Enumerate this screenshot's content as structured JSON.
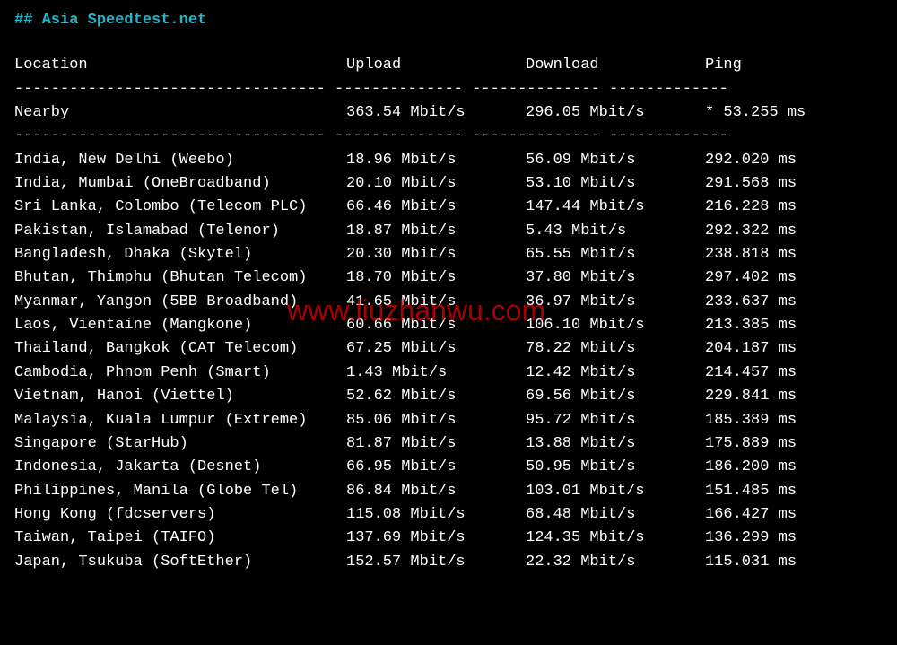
{
  "title": "## Asia Speedtest.net",
  "headers": {
    "location": "Location",
    "upload": "Upload",
    "download": "Download",
    "ping": "Ping"
  },
  "divider_header": "---------------------------------- -------------- -------------- -------------",
  "nearby": {
    "location": "Nearby",
    "upload": "363.54 Mbit/s",
    "download": "296.05 Mbit/s",
    "ping": "* 53.255 ms"
  },
  "divider_nearby": "---------------------------------- -------------- -------------- -------------",
  "rows": [
    {
      "location": "India, New Delhi (Weebo)",
      "upload": "18.96 Mbit/s",
      "download": "56.09 Mbit/s",
      "ping": "292.020 ms"
    },
    {
      "location": "India, Mumbai (OneBroadband)",
      "upload": "20.10 Mbit/s",
      "download": "53.10 Mbit/s",
      "ping": "291.568 ms"
    },
    {
      "location": "Sri Lanka, Colombo (Telecom PLC)",
      "upload": "66.46 Mbit/s",
      "download": "147.44 Mbit/s",
      "ping": "216.228 ms"
    },
    {
      "location": "Pakistan, Islamabad (Telenor)",
      "upload": "18.87 Mbit/s",
      "download": "5.43 Mbit/s",
      "ping": "292.322 ms"
    },
    {
      "location": "Bangladesh, Dhaka (Skytel)",
      "upload": "20.30 Mbit/s",
      "download": "65.55 Mbit/s",
      "ping": "238.818 ms"
    },
    {
      "location": "Bhutan, Thimphu (Bhutan Telecom)",
      "upload": "18.70 Mbit/s",
      "download": "37.80 Mbit/s",
      "ping": "297.402 ms"
    },
    {
      "location": "Myanmar, Yangon (5BB Broadband)",
      "upload": "41.65 Mbit/s",
      "download": "36.97 Mbit/s",
      "ping": "233.637 ms"
    },
    {
      "location": "Laos, Vientaine (Mangkone)",
      "upload": "60.66 Mbit/s",
      "download": "106.10 Mbit/s",
      "ping": "213.385 ms"
    },
    {
      "location": "Thailand, Bangkok (CAT Telecom)",
      "upload": "67.25 Mbit/s",
      "download": "78.22 Mbit/s",
      "ping": "204.187 ms"
    },
    {
      "location": "Cambodia, Phnom Penh (Smart)",
      "upload": "1.43 Mbit/s",
      "download": "12.42 Mbit/s",
      "ping": "214.457 ms"
    },
    {
      "location": "Vietnam, Hanoi (Viettel)",
      "upload": "52.62 Mbit/s",
      "download": "69.56 Mbit/s",
      "ping": "229.841 ms"
    },
    {
      "location": "Malaysia, Kuala Lumpur (Extreme)",
      "upload": "85.06 Mbit/s",
      "download": "95.72 Mbit/s",
      "ping": "185.389 ms"
    },
    {
      "location": "Singapore (StarHub)",
      "upload": "81.87 Mbit/s",
      "download": "13.88 Mbit/s",
      "ping": "175.889 ms"
    },
    {
      "location": "Indonesia, Jakarta (Desnet)",
      "upload": "66.95 Mbit/s",
      "download": "50.95 Mbit/s",
      "ping": "186.200 ms"
    },
    {
      "location": "Philippines, Manila (Globe Tel)",
      "upload": "86.84 Mbit/s",
      "download": "103.01 Mbit/s",
      "ping": "151.485 ms"
    },
    {
      "location": "Hong Kong (fdcservers)",
      "upload": "115.08 Mbit/s",
      "download": "68.48 Mbit/s",
      "ping": "166.427 ms"
    },
    {
      "location": "Taiwan, Taipei (TAIFO)",
      "upload": "137.69 Mbit/s",
      "download": "124.35 Mbit/s",
      "ping": "136.299 ms"
    },
    {
      "location": "Japan, Tsukuba (SoftEther)",
      "upload": "152.57 Mbit/s",
      "download": "22.32 Mbit/s",
      "ping": "115.031 ms"
    }
  ],
  "watermark": "www.liuzhanwu.com"
}
